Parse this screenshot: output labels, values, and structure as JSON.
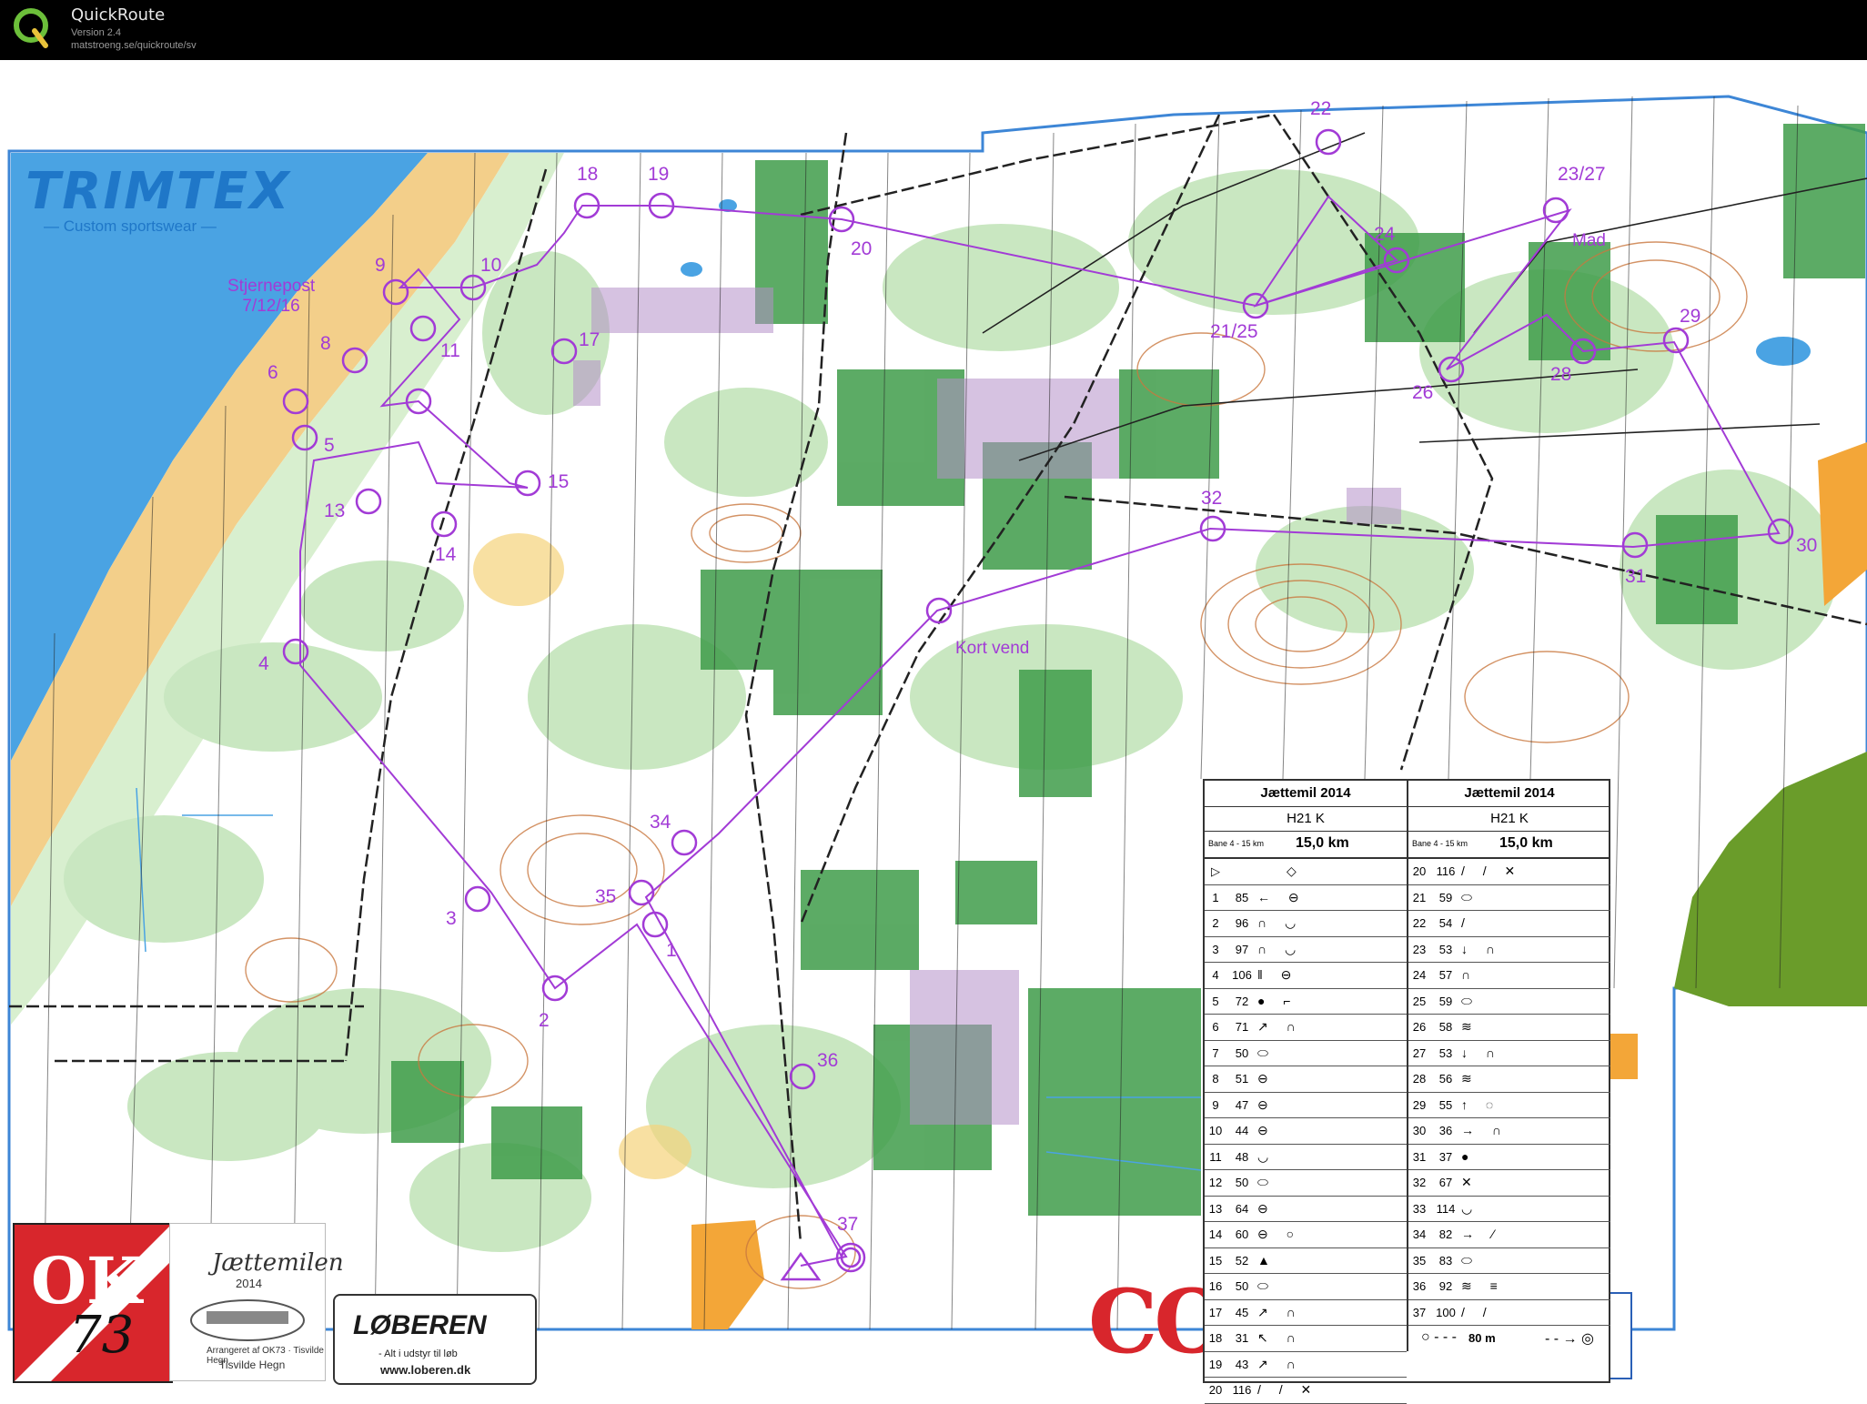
{
  "app": {
    "name": "QuickRoute",
    "version": "Version 2.4",
    "url": "matstroeng.se/quickroute/sv"
  },
  "map": {
    "sponsor_top": "TRIMTEX",
    "sponsor_top_sub": "— Custom sportswear —",
    "star_post_line1": "Stjernepost",
    "star_post_line2": "7/12/16",
    "turn_label": "Kort vend",
    "mad_label": "Mad",
    "scale_label": "80 m",
    "control_numbers": [
      "1",
      "2",
      "3",
      "4",
      "5",
      "6",
      "8",
      "9",
      "10",
      "11",
      "13",
      "14",
      "15",
      "17",
      "18",
      "19",
      "20",
      "21/25",
      "22",
      "23/27",
      "24",
      "26",
      "28",
      "29",
      "30",
      "31",
      "32",
      "34",
      "35",
      "36",
      "37"
    ],
    "club_logo": "OK",
    "club_number": "73",
    "event_logo_title": "Jættemilen",
    "event_logo_year": "2014",
    "event_logo_line1": "Arrangeret af OK73 · Tisvilde Hegn",
    "event_logo_line2": "Tisvilde Hegn",
    "loberen_name": "LØBEREN",
    "loberen_tag": "- Alt i udstyr til løb",
    "loberen_url": "www.loberen.dk",
    "co_logo": "CO",
    "boxes": [
      "1",
      "2",
      "3"
    ]
  },
  "description_sheet": {
    "title": "Jættemil 2014",
    "class": "H21 K",
    "course": "Bane 4 - 15 km",
    "length": "15,0 km",
    "left_rows": [
      {
        "num": "1",
        "code": "85",
        "sym": "← ⊖"
      },
      {
        "num": "2",
        "code": "96",
        "sym": "∩ ◡"
      },
      {
        "num": "3",
        "code": "97",
        "sym": "∩ ◡"
      },
      {
        "num": "4",
        "code": "106",
        "sym": "‖ ⊖"
      },
      {
        "num": "5",
        "code": "72",
        "sym": "●  ⌐"
      },
      {
        "num": "6",
        "code": "71",
        "sym": "↗ ∩"
      },
      {
        "num": "7",
        "code": "50",
        "sym": "⬭"
      },
      {
        "num": "8",
        "code": "51",
        "sym": "⊖"
      },
      {
        "num": "9",
        "code": "47",
        "sym": "⊖"
      },
      {
        "num": "10",
        "code": "44",
        "sym": "⊖"
      },
      {
        "num": "11",
        "code": "48",
        "sym": "◡"
      },
      {
        "num": "12",
        "code": "50",
        "sym": "⬭"
      },
      {
        "num": "13",
        "code": "64",
        "sym": "⊖"
      },
      {
        "num": "14",
        "code": "60",
        "sym": "⊖   ○"
      },
      {
        "num": "15",
        "code": "52",
        "sym": "▲"
      },
      {
        "num": "16",
        "code": "50",
        "sym": "⬭"
      },
      {
        "num": "17",
        "code": "45",
        "sym": "↗ ∩"
      },
      {
        "num": "18",
        "code": "31",
        "sym": "↖ ∩"
      },
      {
        "num": "19",
        "code": "43",
        "sym": "↗ ∩"
      },
      {
        "num": "20",
        "code": "116",
        "sym": "/ / ✕"
      }
    ],
    "right_rows": [
      {
        "num": "20",
        "code": "116",
        "sym": "/ / ✕"
      },
      {
        "num": "21",
        "code": "59",
        "sym": "⬭"
      },
      {
        "num": "22",
        "code": "54",
        "sym": "/"
      },
      {
        "num": "23",
        "code": "53",
        "sym": "↓ ∩"
      },
      {
        "num": "24",
        "code": "57",
        "sym": "∩"
      },
      {
        "num": "25",
        "code": "59",
        "sym": "⬭"
      },
      {
        "num": "26",
        "code": "58",
        "sym": "≋"
      },
      {
        "num": "27",
        "code": "53",
        "sym": "↓ ∩"
      },
      {
        "num": "28",
        "code": "56",
        "sym": "≋"
      },
      {
        "num": "29",
        "code": "55",
        "sym": "↑ ◌"
      },
      {
        "num": "30",
        "code": "36",
        "sym": "→ ∩"
      },
      {
        "num": "31",
        "code": "37",
        "sym": "●"
      },
      {
        "num": "32",
        "code": "67",
        "sym": "✕"
      },
      {
        "num": "33",
        "code": "114",
        "sym": "◡"
      },
      {
        "num": "34",
        "code": "82",
        "sym": "→ ⁄"
      },
      {
        "num": "35",
        "code": "83",
        "sym": "⬭"
      },
      {
        "num": "36",
        "code": "92",
        "sym": "≋ ≡"
      },
      {
        "num": "37",
        "code": "100",
        "sym": "/ /"
      }
    ]
  },
  "colors": {
    "course_purple": "#a23bd6",
    "forest_green": "#3f9c4a",
    "light_green": "#b8deb0",
    "contour_brown": "#c9783f",
    "water_blue": "#4aa3e3",
    "open_yellow": "#f5d37a"
  }
}
